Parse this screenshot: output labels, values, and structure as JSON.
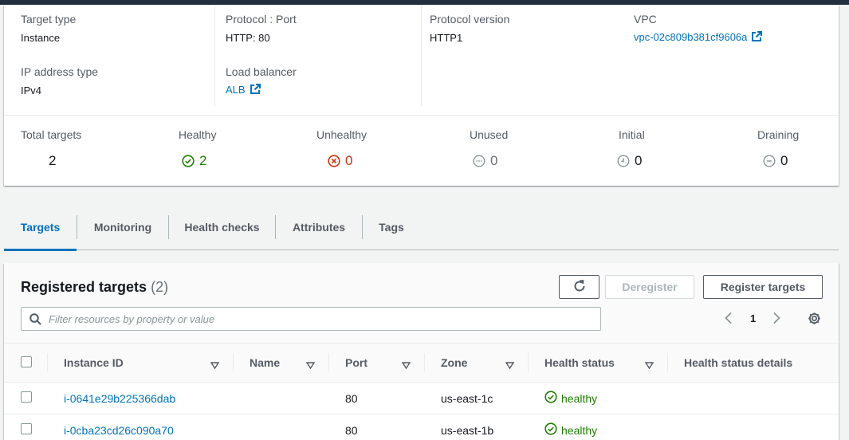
{
  "details": {
    "target_type_label": "Target type",
    "target_type_value": "Instance",
    "protocol_port_label": "Protocol : Port",
    "protocol_port_value": "HTTP: 80",
    "protocol_version_label": "Protocol version",
    "protocol_version_value": "HTTP1",
    "vpc_label": "VPC",
    "vpc_value": "vpc-02c809b381cf9606a",
    "ip_address_type_label": "IP address type",
    "ip_address_type_value": "IPv4",
    "load_balancer_label": "Load balancer",
    "load_balancer_value": "ALB"
  },
  "stats": {
    "total_label": "Total targets",
    "total_value": "2",
    "healthy_label": "Healthy",
    "healthy_value": "2",
    "unhealthy_label": "Unhealthy",
    "unhealthy_value": "0",
    "unused_label": "Unused",
    "unused_value": "0",
    "initial_label": "Initial",
    "initial_value": "0",
    "draining_label": "Draining",
    "draining_value": "0"
  },
  "tabs": [
    {
      "label": "Targets",
      "active": true
    },
    {
      "label": "Monitoring",
      "active": false
    },
    {
      "label": "Health checks",
      "active": false
    },
    {
      "label": "Attributes",
      "active": false
    },
    {
      "label": "Tags",
      "active": false
    }
  ],
  "registered_targets": {
    "title": "Registered targets",
    "count": "(2)",
    "deregister_label": "Deregister",
    "register_label": "Register targets",
    "search_placeholder": "Filter resources by property or value",
    "page_number": "1"
  },
  "table": {
    "columns": [
      "Instance ID",
      "Name",
      "Port",
      "Zone",
      "Health status",
      "Health status details"
    ],
    "rows": [
      {
        "instance_id": "i-0641e29b225366dab",
        "name": "",
        "port": "80",
        "zone": "us-east-1c",
        "health_status": "healthy",
        "details": ""
      },
      {
        "instance_id": "i-0cba23cd26c090a70",
        "name": "",
        "port": "80",
        "zone": "us-east-1b",
        "health_status": "healthy",
        "details": ""
      }
    ]
  },
  "colors": {
    "link": "#0073bb",
    "healthy": "#1d8102",
    "unhealthy": "#d13212",
    "neutral": "#879596"
  }
}
